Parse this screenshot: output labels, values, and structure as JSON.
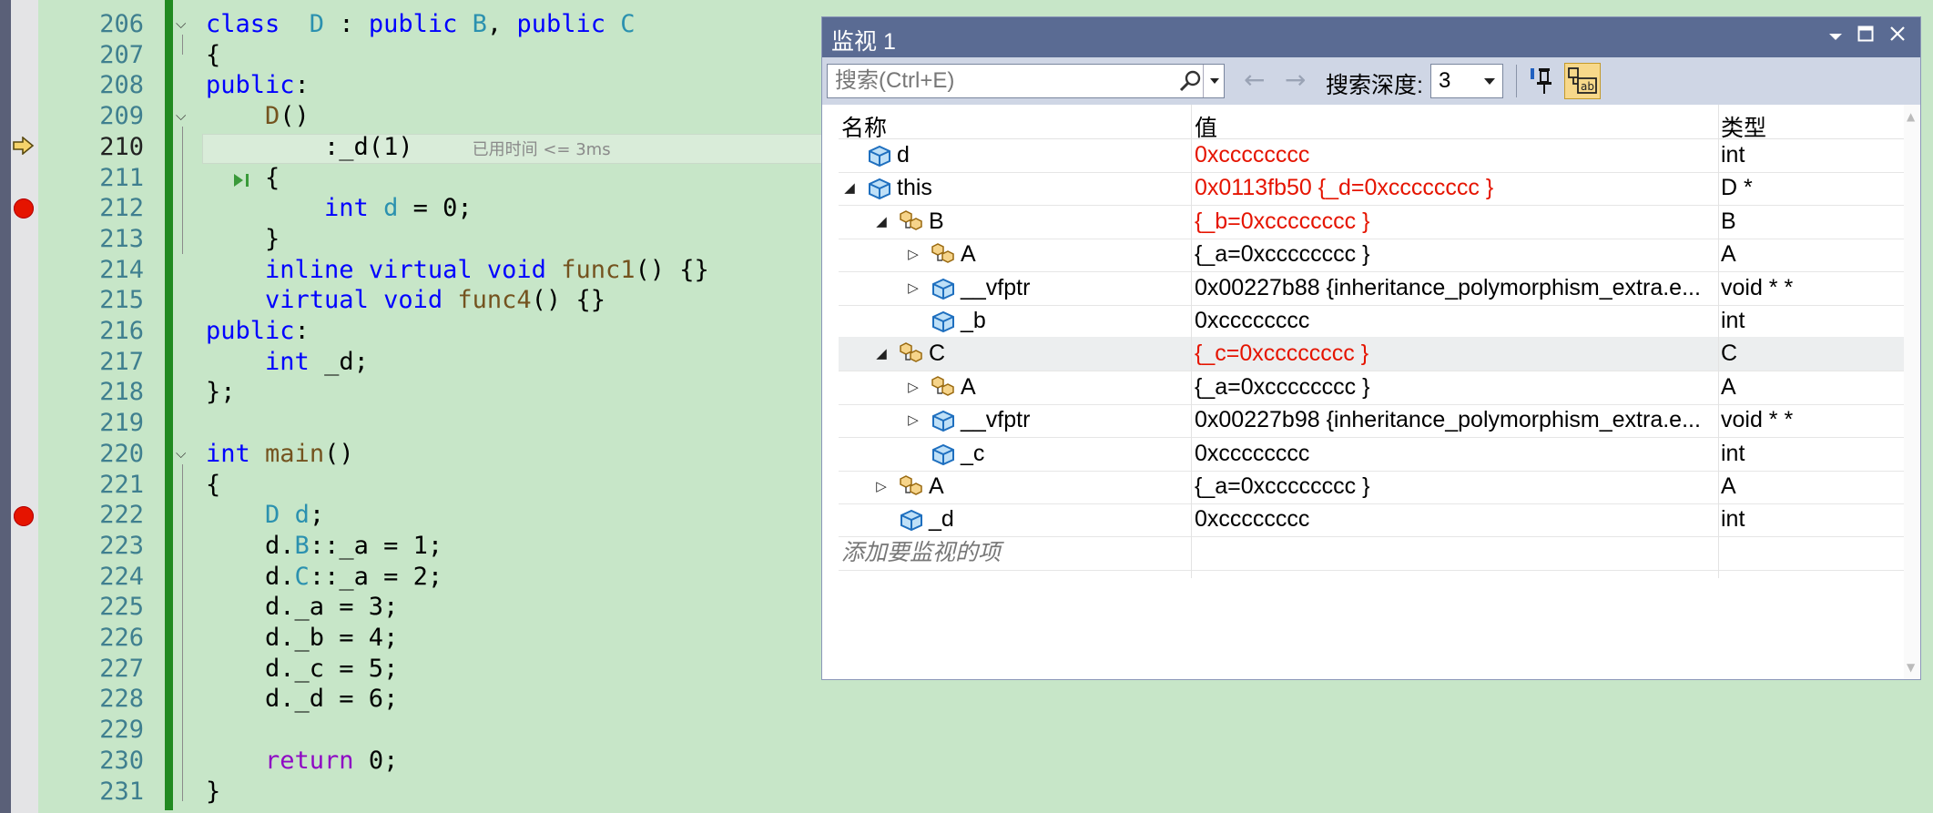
{
  "editor": {
    "lines": [
      {
        "num": "206",
        "code": [
          [
            "kw",
            "class"
          ],
          [
            "",
            "  "
          ],
          [
            "ty",
            "D"
          ],
          [
            "",
            " : "
          ],
          [
            "kw",
            "public"
          ],
          [
            "",
            " "
          ],
          [
            "ty",
            "B"
          ],
          [
            "",
            ", "
          ],
          [
            "kw",
            "public"
          ],
          [
            "",
            " "
          ],
          [
            "ty",
            "C"
          ]
        ]
      },
      {
        "num": "207",
        "code": [
          [
            "",
            "{"
          ]
        ]
      },
      {
        "num": "208",
        "code": [
          [
            "kw",
            "public"
          ],
          [
            "",
            ":"
          ]
        ]
      },
      {
        "num": "209",
        "code": [
          [
            "",
            "    "
          ],
          [
            "fn",
            "D"
          ],
          [
            "",
            "()"
          ]
        ]
      },
      {
        "num": "210",
        "code": [
          [
            "",
            "        :_d(1)"
          ]
        ]
      },
      {
        "num": "211",
        "code": [
          [
            "",
            "    {"
          ]
        ]
      },
      {
        "num": "212",
        "code": [
          [
            "",
            "        "
          ],
          [
            "kw",
            "int"
          ],
          [
            "",
            " "
          ],
          [
            "ty",
            "d"
          ],
          [
            "",
            " = 0;"
          ]
        ]
      },
      {
        "num": "213",
        "code": [
          [
            "",
            "    }"
          ]
        ]
      },
      {
        "num": "214",
        "code": [
          [
            "",
            "    "
          ],
          [
            "kw",
            "inline"
          ],
          [
            "",
            " "
          ],
          [
            "kw",
            "virtual"
          ],
          [
            "",
            " "
          ],
          [
            "kw",
            "void"
          ],
          [
            "",
            " "
          ],
          [
            "fn",
            "func1"
          ],
          [
            "",
            "() {}"
          ]
        ]
      },
      {
        "num": "215",
        "code": [
          [
            "",
            "    "
          ],
          [
            "kw",
            "virtual"
          ],
          [
            "",
            " "
          ],
          [
            "kw",
            "void"
          ],
          [
            "",
            " "
          ],
          [
            "fn",
            "func4"
          ],
          [
            "",
            "() {}"
          ]
        ]
      },
      {
        "num": "216",
        "code": [
          [
            "kw",
            "public"
          ],
          [
            "",
            ":"
          ]
        ]
      },
      {
        "num": "217",
        "code": [
          [
            "",
            "    "
          ],
          [
            "kw",
            "int"
          ],
          [
            "",
            " _d;"
          ]
        ]
      },
      {
        "num": "218",
        "code": [
          [
            "",
            "};"
          ]
        ]
      },
      {
        "num": "219",
        "code": []
      },
      {
        "num": "220",
        "code": [
          [
            "kw",
            "int"
          ],
          [
            "",
            " "
          ],
          [
            "fn",
            "main"
          ],
          [
            "",
            "()"
          ]
        ]
      },
      {
        "num": "221",
        "code": [
          [
            "",
            "{"
          ]
        ]
      },
      {
        "num": "222",
        "code": [
          [
            "",
            "    "
          ],
          [
            "ty",
            "D"
          ],
          [
            "",
            " "
          ],
          [
            "ty",
            "d"
          ],
          [
            "",
            ";"
          ]
        ]
      },
      {
        "num": "223",
        "code": [
          [
            "",
            "    d."
          ],
          [
            "ty",
            "B"
          ],
          [
            "",
            "::_a = 1;"
          ]
        ]
      },
      {
        "num": "224",
        "code": [
          [
            "",
            "    d."
          ],
          [
            "ty",
            "C"
          ],
          [
            "",
            "::_a = 2;"
          ]
        ]
      },
      {
        "num": "225",
        "code": [
          [
            "",
            "    d._a = 3;"
          ]
        ]
      },
      {
        "num": "226",
        "code": [
          [
            "",
            "    d._b = 4;"
          ]
        ]
      },
      {
        "num": "227",
        "code": [
          [
            "",
            "    d._c = 5;"
          ]
        ]
      },
      {
        "num": "228",
        "code": [
          [
            "",
            "    d._d = 6;"
          ]
        ]
      },
      {
        "num": "229",
        "code": []
      },
      {
        "num": "230",
        "code": [
          [
            "",
            "    "
          ],
          [
            "ret",
            "return"
          ],
          [
            "",
            " 0;"
          ]
        ]
      },
      {
        "num": "231",
        "code": [
          [
            "",
            "}"
          ]
        ]
      }
    ],
    "elapsed_hint": "已用时间 <= 3ms",
    "colors": {
      "keyword": "#0000ff",
      "type": "#2b91af",
      "function": "#74531f",
      "return": "#8f08c4",
      "breakpoint": "#e51400",
      "change_bar": "#218a21"
    }
  },
  "watch": {
    "title": "监视 1",
    "search_placeholder": "搜索(Ctrl+E)",
    "depth_label": "搜索深度:",
    "depth_value": "3",
    "columns": {
      "name": "名称",
      "value": "值",
      "type": "类型"
    },
    "rows": [
      {
        "name": "d",
        "value": "0xcccccccc",
        "type": "int",
        "changed": true,
        "level": 0,
        "expand": "",
        "icon": "field-icon"
      },
      {
        "name": "this",
        "value": "0x0113fb50 {_d=0xcccccccc }",
        "type": "D *",
        "changed": true,
        "level": 0,
        "expand": "down",
        "icon": "field-icon"
      },
      {
        "name": "B",
        "value": "{_b=0xcccccccc }",
        "type": "B",
        "changed": true,
        "level": 1,
        "expand": "down",
        "icon": "base-class-icon"
      },
      {
        "name": "A",
        "value": "{_a=0xcccccccc }",
        "type": "A",
        "changed": false,
        "level": 2,
        "expand": "right",
        "icon": "base-class-icon"
      },
      {
        "name": "__vfptr",
        "value": "0x00227b88 {inheritance_polymorphism_extra.e...",
        "type": "void * *",
        "changed": false,
        "level": 2,
        "expand": "right",
        "icon": "field-icon"
      },
      {
        "name": "_b",
        "value": "0xcccccccc",
        "type": "int",
        "changed": false,
        "level": 2,
        "expand": "",
        "icon": "field-icon"
      },
      {
        "name": "C",
        "value": "{_c=0xcccccccc }",
        "type": "C",
        "changed": true,
        "level": 1,
        "expand": "down",
        "icon": "base-class-icon",
        "selected": true
      },
      {
        "name": "A",
        "value": "{_a=0xcccccccc }",
        "type": "A",
        "changed": false,
        "level": 2,
        "expand": "right",
        "icon": "base-class-icon"
      },
      {
        "name": "__vfptr",
        "value": "0x00227b98 {inheritance_polymorphism_extra.e...",
        "type": "void * *",
        "changed": false,
        "level": 2,
        "expand": "right",
        "icon": "field-icon"
      },
      {
        "name": "_c",
        "value": "0xcccccccc",
        "type": "int",
        "changed": false,
        "level": 2,
        "expand": "",
        "icon": "field-icon"
      },
      {
        "name": "A",
        "value": "{_a=0xcccccccc }",
        "type": "A",
        "changed": false,
        "level": 1,
        "expand": "right",
        "icon": "base-class-icon"
      },
      {
        "name": "_d",
        "value": "0xcccccccc",
        "type": "int",
        "changed": false,
        "level": 1,
        "expand": "",
        "icon": "field-icon"
      }
    ],
    "add_item_hint": "添加要监视的项",
    "colors": {
      "title_bar": "#5a6b93",
      "changed_value": "#e51400",
      "toolbar": "#cfd6e5"
    }
  }
}
